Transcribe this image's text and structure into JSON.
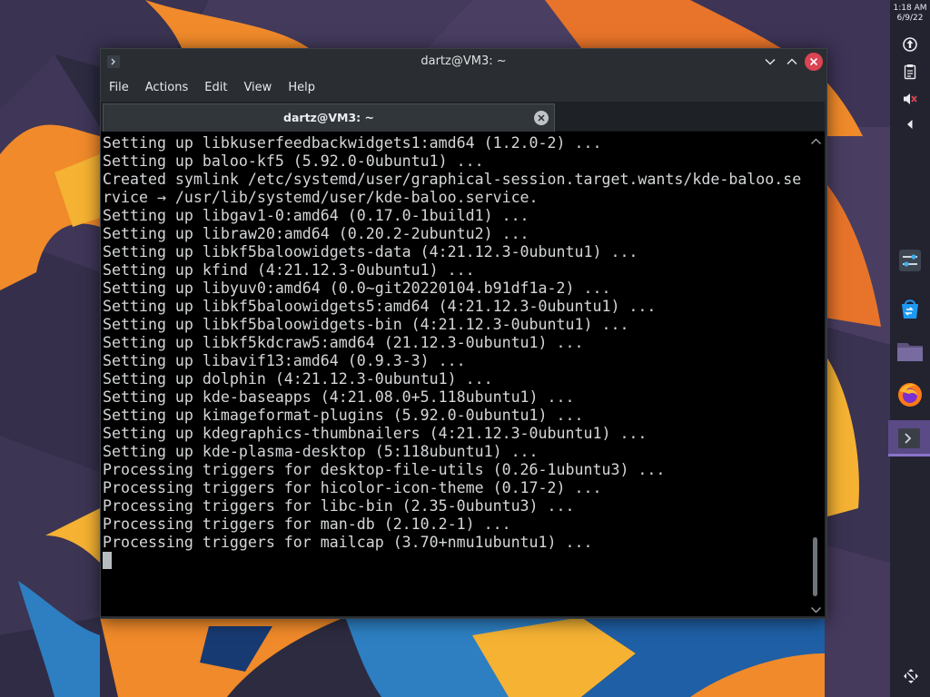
{
  "desktop": {
    "colors": {
      "background": "#2b2a3e",
      "orange": "#f08a2a",
      "yellow": "#f5b233",
      "blue": "#2d7fc2",
      "dark_blue": "#183a72"
    }
  },
  "panel": {
    "clock_time": "1:18 AM",
    "clock_date": "6/9/22",
    "tray_icons": [
      "updates-icon",
      "clipboard-icon",
      "muted-speaker-icon",
      "show-hidden-icons-icon"
    ],
    "task_icons": [
      "system-settings-icon",
      "discover-store-icon",
      "dolphin-folder-icon",
      "firefox-icon",
      "konsole-terminal-icon"
    ],
    "active_task": "konsole-terminal-icon",
    "bottom_icon": "workspace-expand-icon"
  },
  "window": {
    "title": "dartz@VM3: ~",
    "menu": [
      "File",
      "Actions",
      "Edit",
      "View",
      "Help"
    ],
    "tab_label": "dartz@VM3: ~",
    "colors": {
      "titlebar": "#2a2e32",
      "close": "#da4453",
      "terminal_bg": "#000000",
      "terminal_fg": "#d4d6d8"
    }
  },
  "terminal": {
    "lines": [
      "Setting up libkuserfeedbackwidgets1:amd64 (1.2.0-2) ...",
      "Setting up baloo-kf5 (5.92.0-0ubuntu1) ...",
      "Created symlink /etc/systemd/user/graphical-session.target.wants/kde-baloo.se",
      "rvice → /usr/lib/systemd/user/kde-baloo.service.",
      "Setting up libgav1-0:amd64 (0.17.0-1build1) ...",
      "Setting up libraw20:amd64 (0.20.2-2ubuntu2) ...",
      "Setting up libkf5baloowidgets-data (4:21.12.3-0ubuntu1) ...",
      "Setting up kfind (4:21.12.3-0ubuntu1) ...",
      "Setting up libyuv0:amd64 (0.0~git20220104.b91df1a-2) ...",
      "Setting up libkf5baloowidgets5:amd64 (4:21.12.3-0ubuntu1) ...",
      "Setting up libkf5baloowidgets-bin (4:21.12.3-0ubuntu1) ...",
      "Setting up libkf5kdcraw5:amd64 (21.12.3-0ubuntu1) ...",
      "Setting up libavif13:amd64 (0.9.3-3) ...",
      "Setting up dolphin (4:21.12.3-0ubuntu1) ...",
      "Setting up kde-baseapps (4:21.08.0+5.118ubuntu1) ...",
      "Setting up kimageformat-plugins (5.92.0-0ubuntu1) ...",
      "Setting up kdegraphics-thumbnailers (4:21.12.3-0ubuntu1) ...",
      "Setting up kde-plasma-desktop (5:118ubuntu1) ...",
      "Processing triggers for desktop-file-utils (0.26-1ubuntu3) ...",
      "Processing triggers for hicolor-icon-theme (0.17-2) ...",
      "Processing triggers for libc-bin (2.35-0ubuntu3) ...",
      "Processing triggers for man-db (2.10.2-1) ...",
      "Processing triggers for mailcap (3.70+nmu1ubuntu1) ..."
    ]
  }
}
